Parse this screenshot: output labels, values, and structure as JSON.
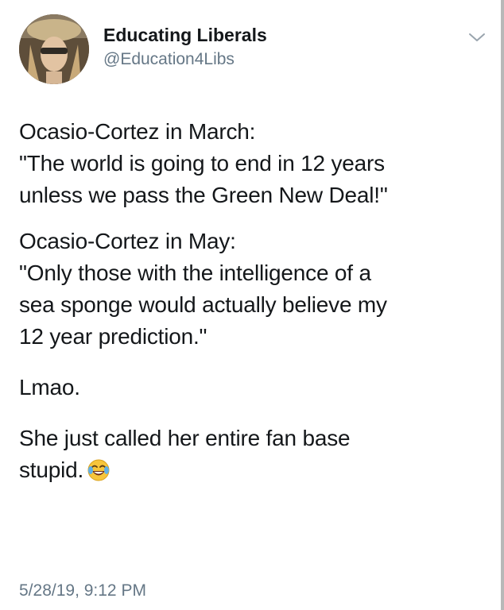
{
  "tweet": {
    "display_name": "Educating Liberals",
    "handle": "@Education4Libs",
    "body": {
      "p1_line1": "Ocasio-Cortez in March:",
      "p1_line2": "\"The world is going to end in 12 years",
      "p1_line3": "unless we pass the Green New Deal!\"",
      "p2_line1": "Ocasio-Cortez in May:",
      "p2_line2": "\"Only those with the intelligence of a",
      "p2_line3": "sea sponge would actually believe my",
      "p2_line4": "12 year prediction.\"",
      "p3_line1": "Lmao.",
      "p4_line1": "She just called her entire fan base",
      "p4_line2": "stupid."
    },
    "emoji": "face-with-tears-of-joy-icon",
    "timestamp": "5/28/19, 9:12 PM"
  },
  "icons": {
    "menu": "chevron-down-icon",
    "avatar": "avatar"
  },
  "colors": {
    "text_primary": "#14171a",
    "text_secondary": "#657786",
    "background": "#ffffff"
  }
}
